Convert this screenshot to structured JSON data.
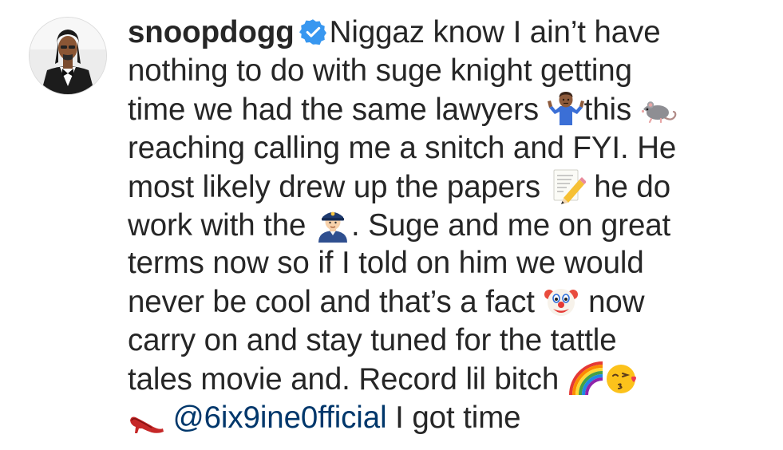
{
  "comment": {
    "username": "snoopdogg",
    "verified_icon": "verified-badge-icon",
    "mention": "@6ix9ine0fficial",
    "lines": [
      [
        "Niggaz know I ain’t have"
      ],
      [
        "nothing to do with suge knight getting"
      ],
      [
        "time we had the same lawyers ",
        "this "
      ],
      [
        "reaching calling me a snitch  and  FYI. He"
      ],
      [
        "most likely drew up the papers ",
        " he do"
      ],
      [
        "work with the ",
        ". Suge and me on great"
      ],
      [
        "terms now  so if I told on him we would"
      ],
      [
        "never be cool and that’s a fact ",
        " now"
      ],
      [
        "carry on and stay tuned for the tattle"
      ],
      [
        "tales movie and. Record  lil bitch "
      ],
      [
        " I got time"
      ]
    ],
    "emojis": {
      "shrug": "shrug-emoji-icon",
      "rat": "rat-emoji-icon",
      "memo": "memo-pencil-emoji-icon",
      "police": "police-officer-emoji-icon",
      "clown": "clown-face-emoji-icon",
      "rainbow": "rainbow-emoji-icon",
      "kiss": "face-blowing-kiss-emoji-icon",
      "heel": "high-heel-emoji-icon"
    },
    "colors": {
      "text": "#262626",
      "mention": "#00376b",
      "verified": "#3897f0"
    }
  }
}
